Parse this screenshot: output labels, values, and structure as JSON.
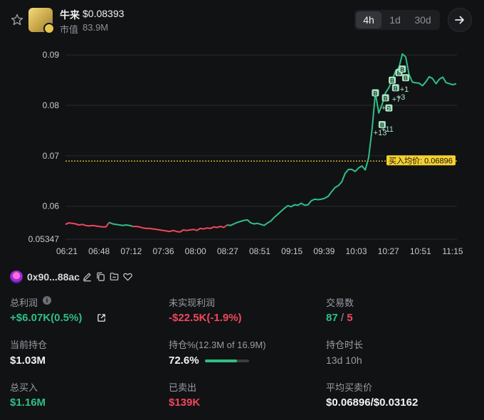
{
  "token": {
    "name": "牛来",
    "price": "$0.08393",
    "mcap_label": "市值",
    "mcap_value": "83.9M"
  },
  "timeframes": [
    {
      "label": "4h",
      "active": true
    },
    {
      "label": "1d",
      "active": false
    },
    {
      "label": "30d",
      "active": false
    }
  ],
  "icons": {
    "favorite": "star-icon",
    "next": "arrow-right-icon",
    "copy": "copy-icon",
    "edit": "edit-icon",
    "folder": "folder-icon",
    "heart": "heart-icon",
    "info": "info-icon",
    "share": "external-link-icon"
  },
  "colors": {
    "up": "#2fbf86",
    "down": "#f0475c",
    "avg_line": "#f5d130",
    "buy_marker": "#a6e3c4"
  },
  "chart_data": {
    "type": "line",
    "y_ticks": [
      "0.09",
      "0.08",
      "0.07",
      "0.06",
      "0.05347"
    ],
    "y_tick_values": [
      0.09,
      0.08,
      0.07,
      0.06,
      0.05347
    ],
    "ylim": [
      0.05347,
      0.0913
    ],
    "x_ticks": [
      "06:21",
      "06:48",
      "07:12",
      "07:36",
      "08:00",
      "08:27",
      "08:51",
      "09:15",
      "09:39",
      "10:03",
      "10:27",
      "10:51",
      "11:15"
    ],
    "avg_price": 0.06896,
    "avg_label": "买入均价: 0.06896",
    "series": [
      {
        "values": [
          0.0564,
          0.0567,
          0.0566,
          0.0565,
          0.0563,
          0.0564,
          0.0562,
          0.0561,
          0.0562,
          0.0561,
          0.056,
          0.0559,
          0.0559,
          0.0568,
          0.0565,
          0.0564,
          0.0563,
          0.0562,
          0.0563,
          0.0562,
          0.056,
          0.056,
          0.0559,
          0.0557,
          0.0556,
          0.0556,
          0.0555,
          0.0554,
          0.0553,
          0.0552,
          0.0551,
          0.055,
          0.0552,
          0.055,
          0.0549,
          0.0553,
          0.0552,
          0.0553,
          0.0554,
          0.0552,
          0.0556,
          0.0555,
          0.0557,
          0.0556,
          0.0559,
          0.0558,
          0.056,
          0.0558,
          0.0563,
          0.0562,
          0.0565,
          0.0568,
          0.057,
          0.0572,
          0.0573,
          0.0567,
          0.0565,
          0.0566,
          0.0564,
          0.0562,
          0.0567,
          0.0571,
          0.0578,
          0.0584,
          0.059,
          0.0596,
          0.0601,
          0.0599,
          0.0603,
          0.0602,
          0.0606,
          0.0602,
          0.0603,
          0.0611,
          0.0614,
          0.0613,
          0.0614,
          0.0616,
          0.062,
          0.0629,
          0.0637,
          0.0641,
          0.0648,
          0.0665,
          0.0673,
          0.0673,
          0.0669,
          0.0676,
          0.068,
          0.0672,
          0.0696,
          0.0752,
          0.0825,
          0.0785,
          0.0802,
          0.0825,
          0.0835,
          0.0851,
          0.0868,
          0.0875,
          0.0902,
          0.0896,
          0.0861,
          0.0846,
          0.0845,
          0.0844,
          0.0839,
          0.0847,
          0.0857,
          0.0853,
          0.0843,
          0.0852,
          0.0856,
          0.0845,
          0.0843,
          0.0841,
          0.0843
        ]
      }
    ],
    "marker_values": [
      0.0825,
      0.0762,
      0.0815,
      0.0795,
      0.085,
      0.0835,
      0.0865,
      0.0872,
      0.0855
    ],
    "marker_labels": [
      "B",
      "+13",
      "+5",
      "+11",
      "+7",
      "+3",
      "+1"
    ]
  },
  "wallet": {
    "address": "0x90...88ac"
  },
  "stats": {
    "total_profit_label": "总利润",
    "total_profit_value": "+$6.07K(0.5%)",
    "unrealized_label": "未实现利润",
    "unrealized_value": "-$22.5K(-1.9%)",
    "trades_label": "交易数",
    "trades_buys": "87",
    "trades_sep": "/",
    "trades_sells": "5",
    "holding_label": "当前持仓",
    "holding_value": "$1.03M",
    "position_label": "持仓%(12.3M of 16.9M)",
    "position_value": "72.6%",
    "position_fraction": 0.726,
    "hold_time_label": "持仓时长",
    "hold_time_value": "13d 10h",
    "total_bought_label": "总买入",
    "total_bought_value": "$1.16M",
    "sold_label": "已卖出",
    "sold_value": "$139K",
    "avg_price_label": "平均买卖价",
    "avg_price_value": "$0.06896/$0.03162"
  }
}
